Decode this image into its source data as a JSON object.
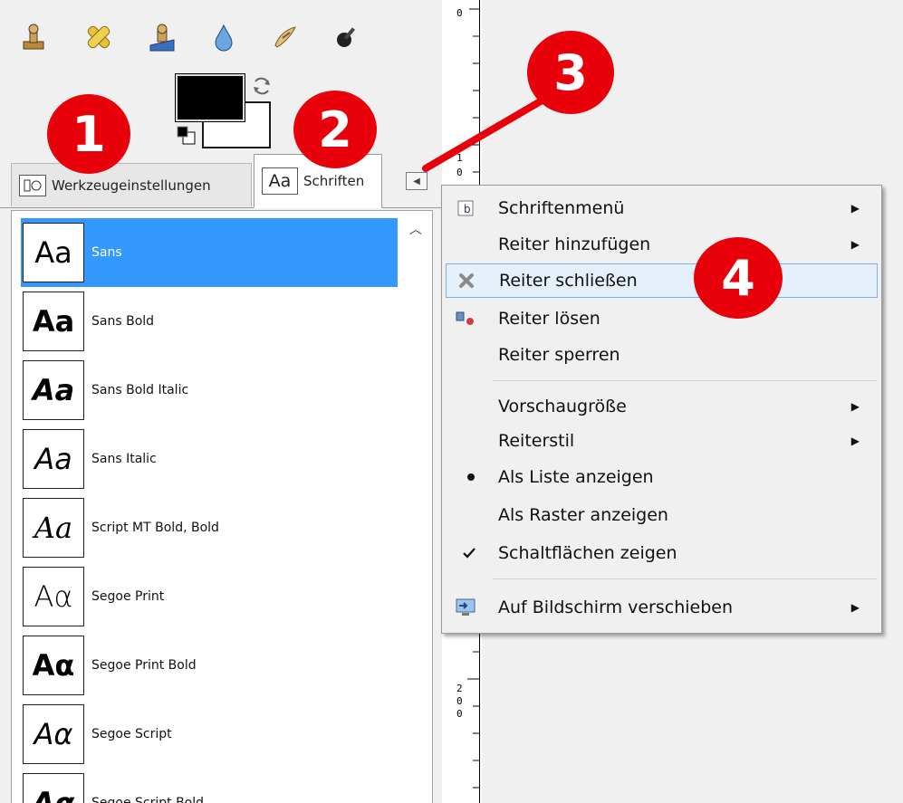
{
  "toolbox": {
    "tools": [
      {
        "name": "clone-stamp-icon"
      },
      {
        "name": "heal-icon"
      },
      {
        "name": "perspective-clone-icon"
      },
      {
        "name": "blur-sharpen-icon"
      },
      {
        "name": "smudge-icon"
      },
      {
        "name": "dodge-burn-icon"
      }
    ],
    "foreground_color": "#000000",
    "background_color": "#ffffff"
  },
  "tabs": {
    "tool_options": {
      "icon_text": "🔧",
      "label": "Werkzeugeinstellungen"
    },
    "fonts": {
      "icon_text": "Aa",
      "label": "Schriften"
    }
  },
  "fonts": [
    {
      "preview": "Aa",
      "name": "Sans"
    },
    {
      "preview": "Aa",
      "name": "Sans Bold"
    },
    {
      "preview": "Aa",
      "name": "Sans Bold Italic"
    },
    {
      "preview": "Aa",
      "name": "Sans Italic"
    },
    {
      "preview": "Aa",
      "name": "Script MT Bold, Bold"
    },
    {
      "preview": "Aα",
      "name": "Segoe Print"
    },
    {
      "preview": "Aα",
      "name": "Segoe Print Bold"
    },
    {
      "preview": "Aα",
      "name": "Segoe Script"
    },
    {
      "preview": "Aα",
      "name": "Segoe Script Bold"
    }
  ],
  "ruler": {
    "labels": [
      "0",
      "1",
      "0",
      "2",
      "0",
      "0"
    ]
  },
  "menu": {
    "items": [
      {
        "label": "Schriftenmenü",
        "submenu": true
      },
      {
        "label": "Reiter hinzufügen",
        "submenu": true
      },
      {
        "label": "Reiter schließen",
        "submenu": false
      },
      {
        "label": "Reiter lösen",
        "submenu": false
      },
      {
        "label": "Reiter sperren",
        "submenu": false
      },
      {
        "label": "Vorschaugröße",
        "submenu": true
      },
      {
        "label": "Reiterstil",
        "submenu": true
      },
      {
        "label": "Als Liste anzeigen",
        "submenu": false
      },
      {
        "label": "Als Raster anzeigen",
        "submenu": false
      },
      {
        "label": "Schaltflächen zeigen",
        "submenu": false
      },
      {
        "label": "Auf Bildschirm verschieben",
        "submenu": true
      }
    ]
  },
  "callouts": [
    "1",
    "2",
    "3",
    "4"
  ],
  "colors": {
    "selection": "#3399ff",
    "callout": "#e8000b",
    "menu_highlight": "#e6f0fb"
  }
}
